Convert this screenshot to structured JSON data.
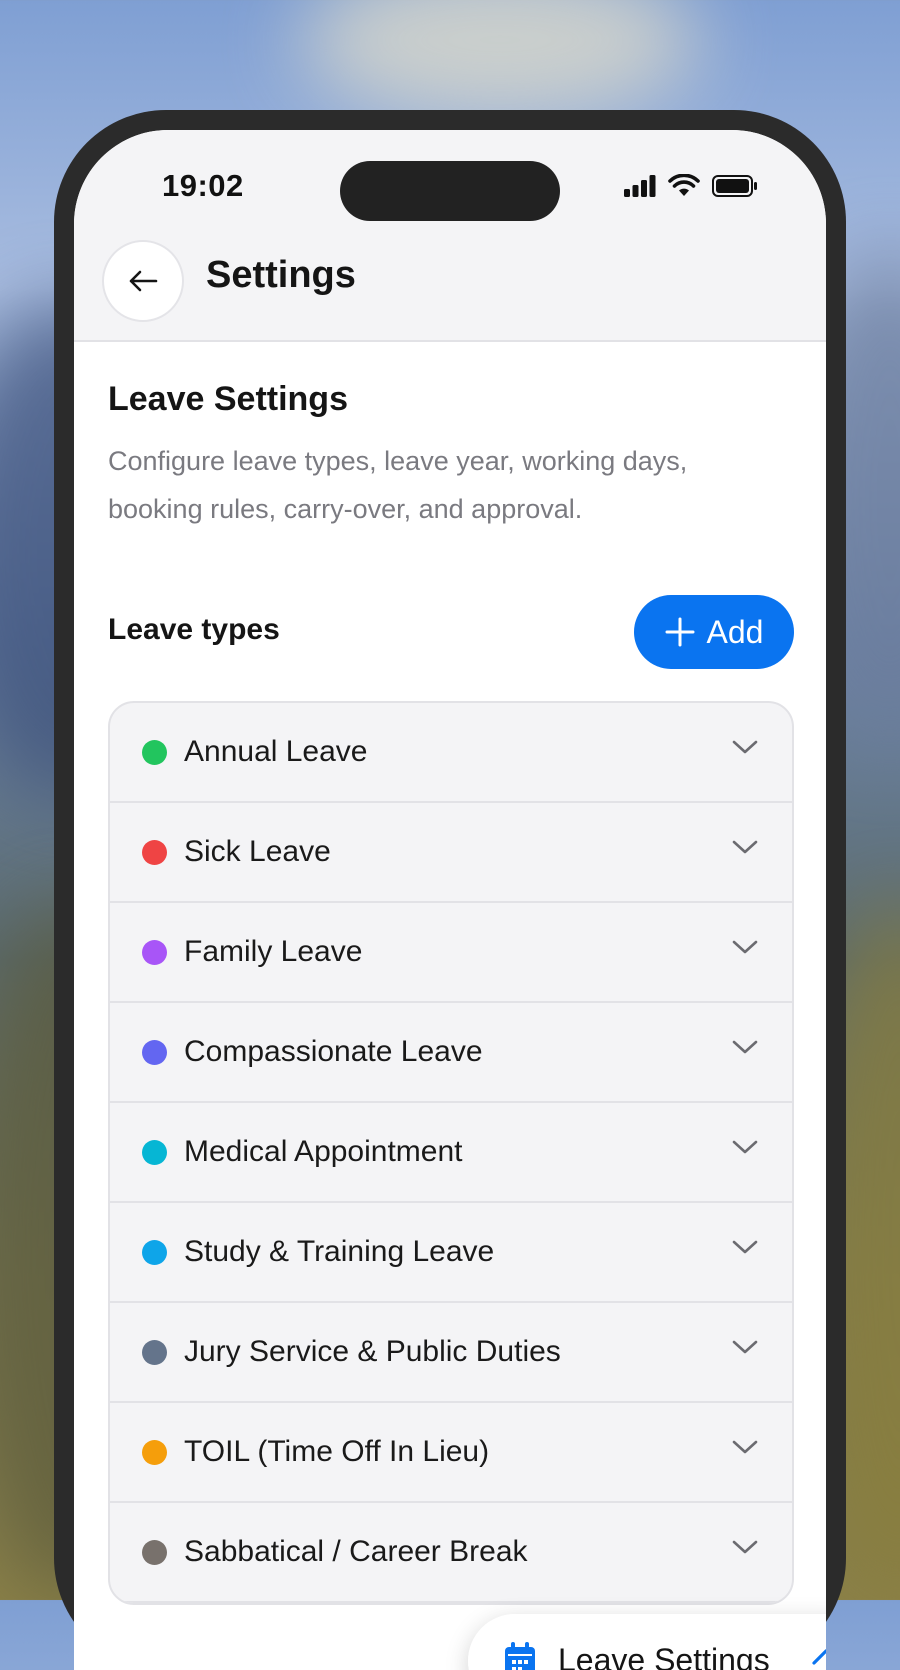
{
  "status_bar": {
    "time": "19:02"
  },
  "header": {
    "title": "Settings"
  },
  "section": {
    "title": "Leave Settings",
    "description": "Configure leave types, leave year, working days, booking rules, carry-over, and approval."
  },
  "leave_types": {
    "label": "Leave types",
    "add_label": "Add",
    "items": [
      {
        "label": "Annual Leave",
        "color": "#22c55e"
      },
      {
        "label": "Sick Leave",
        "color": "#ef4444"
      },
      {
        "label": "Family Leave",
        "color": "#a855f7"
      },
      {
        "label": "Compassionate Leave",
        "color": "#6366f1"
      },
      {
        "label": "Medical Appointment",
        "color": "#06b6d4"
      },
      {
        "label": "Study & Training Leave",
        "color": "#0ea5e9"
      },
      {
        "label": "Jury Service & Public Duties",
        "color": "#64748b"
      },
      {
        "label": "TOIL (Time Off In Lieu)",
        "color": "#f59e0b"
      },
      {
        "label": "Sabbatical / Career Break",
        "color": "#78716c"
      }
    ]
  },
  "floating_nav": {
    "label": "Leave Settings",
    "icon": "calendar-icon",
    "accent": "#0a74f0"
  }
}
